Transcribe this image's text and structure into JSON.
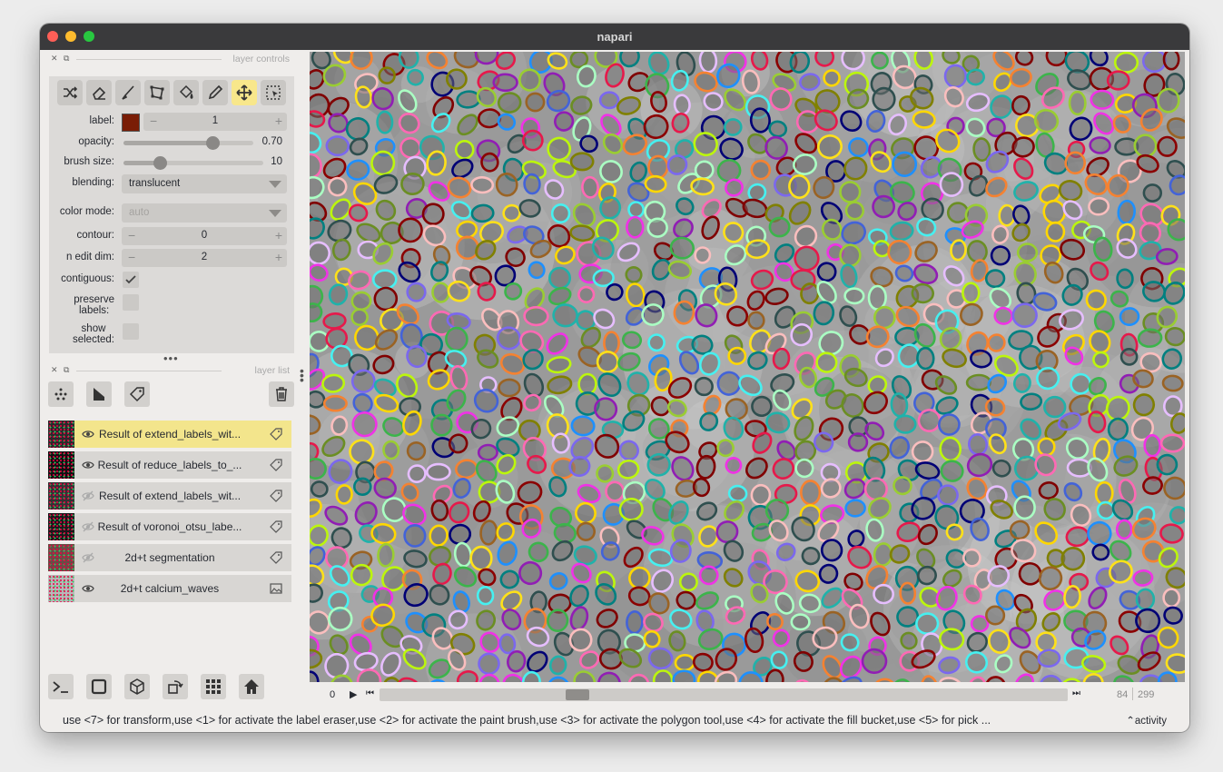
{
  "window": {
    "title": "napari"
  },
  "layer_controls": {
    "header": "layer controls",
    "tools": [
      "transform-icon",
      "eraser-icon",
      "paint-brush-icon",
      "polygon-icon",
      "fill-bucket-icon",
      "color-picker-icon",
      "pan-zoom-icon",
      "select-icon"
    ],
    "active_tool": "pan-zoom-icon",
    "label": {
      "label": "label:",
      "value": "1",
      "color": "#7a1d06"
    },
    "opacity": {
      "label": "opacity:",
      "value": "0.70",
      "fraction": 0.7
    },
    "brush_size": {
      "label": "brush size:",
      "value": "10",
      "fraction": 0.27
    },
    "blending": {
      "label": "blending:",
      "value": "translucent"
    },
    "color_mode": {
      "label": "color mode:",
      "value": "auto"
    },
    "contour": {
      "label": "contour:",
      "value": "0"
    },
    "n_edit_dim": {
      "label": "n edit dim:",
      "value": "2"
    },
    "contiguous": {
      "label": "contiguous:",
      "checked": true
    },
    "preserve_labels": {
      "label_line1": "preserve",
      "label_line2": "labels:",
      "checked": false
    },
    "show_selected": {
      "label_line1": "show",
      "label_line2": "selected:",
      "checked": false
    }
  },
  "layer_list": {
    "header": "layer list",
    "layers": [
      {
        "name": "Result of extend_labels_wit...",
        "visible": true,
        "selected": true,
        "kind": "labels"
      },
      {
        "name": "Result of reduce_labels_to_...",
        "visible": true,
        "selected": false,
        "kind": "labels"
      },
      {
        "name": "Result of extend_labels_wit...",
        "visible": false,
        "selected": false,
        "kind": "labels"
      },
      {
        "name": "Result of voronoi_otsu_labe...",
        "visible": false,
        "selected": false,
        "kind": "labels"
      },
      {
        "name": "2d+t segmentation",
        "visible": false,
        "selected": false,
        "kind": "labels"
      },
      {
        "name": "2d+t calcium_waves",
        "visible": true,
        "selected": false,
        "kind": "image"
      }
    ]
  },
  "dims": {
    "frame": "0",
    "current": "84",
    "total": "299",
    "fraction": 0.28
  },
  "status": {
    "text": "use <7> for transform,use <1> for activate the label eraser,use <2> for activate the paint brush,use <3> for activate the polygon tool,use <4> for activate the fill bucket,use <5> for pick ...",
    "activity": "activity"
  }
}
